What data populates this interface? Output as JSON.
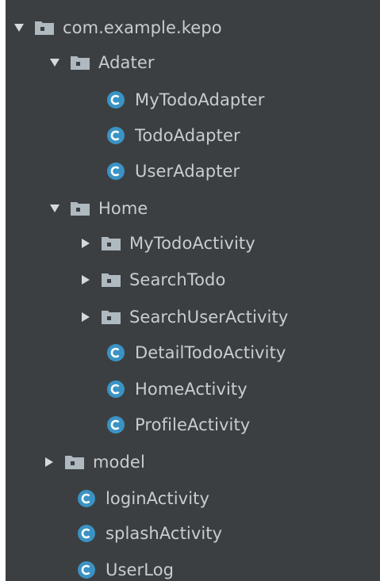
{
  "tree": {
    "nodes": [
      {
        "id": "com-example-kepo",
        "label": "com.example.kepo",
        "type": "package",
        "state": "expanded",
        "icon": "package-icon"
      },
      {
        "id": "adater",
        "label": "Adater",
        "type": "package",
        "state": "expanded",
        "icon": "package-icon"
      },
      {
        "id": "mytodoadapter",
        "label": "MyTodoAdapter",
        "type": "class",
        "state": "leaf",
        "icon": "class-icon"
      },
      {
        "id": "todoadapter",
        "label": "TodoAdapter",
        "type": "class",
        "state": "leaf",
        "icon": "class-icon"
      },
      {
        "id": "useradapter",
        "label": "UserAdapter",
        "type": "class",
        "state": "leaf",
        "icon": "class-icon"
      },
      {
        "id": "home",
        "label": "Home",
        "type": "package",
        "state": "expanded",
        "icon": "package-icon"
      },
      {
        "id": "mytodoactivity",
        "label": "MyTodoActivity",
        "type": "package",
        "state": "collapsed",
        "icon": "package-icon"
      },
      {
        "id": "searchtodo",
        "label": "SearchTodo",
        "type": "package",
        "state": "collapsed",
        "icon": "package-icon"
      },
      {
        "id": "searchuseractivity",
        "label": "SearchUserActivity",
        "type": "package",
        "state": "collapsed",
        "icon": "package-icon"
      },
      {
        "id": "detailtodoactivity",
        "label": "DetailTodoActivity",
        "type": "class",
        "state": "leaf",
        "icon": "class-icon"
      },
      {
        "id": "homeactivity",
        "label": "HomeActivity",
        "type": "class",
        "state": "leaf",
        "icon": "class-icon"
      },
      {
        "id": "profileactivity",
        "label": "ProfileActivity",
        "type": "class",
        "state": "leaf",
        "icon": "class-icon"
      },
      {
        "id": "model",
        "label": "model",
        "type": "package",
        "state": "collapsed",
        "icon": "package-icon"
      },
      {
        "id": "loginactivity",
        "label": "loginActivity",
        "type": "class",
        "state": "leaf",
        "icon": "class-icon"
      },
      {
        "id": "splashactivity",
        "label": "splashActivity",
        "type": "class",
        "state": "leaf",
        "icon": "class-icon"
      },
      {
        "id": "userlog",
        "label": "UserLog",
        "type": "class",
        "state": "leaf",
        "icon": "class-icon"
      }
    ]
  },
  "colors": {
    "background": "#3c3f41",
    "text": "#c8cdd3",
    "arrow": "#d6d8da",
    "folder": "#aeb9c0",
    "folder_dot": "#3c3f41",
    "class_badge": "#3a93c4",
    "class_letter": "#ffffff"
  }
}
